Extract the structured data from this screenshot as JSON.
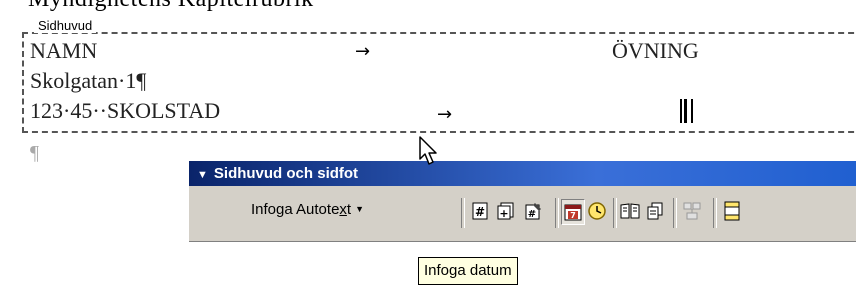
{
  "document": {
    "top_cut_text": "Myndighetens Kapitelrubrik",
    "header_label": "Sidhuvud",
    "lines": [
      {
        "left": "NAMN",
        "right": "ÖVNING"
      },
      {
        "left": "Skolgatan·1¶"
      },
      {
        "left": "123·45··SKOLSTAD"
      }
    ],
    "tab_glyph": "→",
    "body_pilcrow": "¶"
  },
  "toolbar": {
    "title": "Sidhuvud och sidfot",
    "autotext_label_pre": "Infoga Autote",
    "autotext_label_ul": "x",
    "autotext_label_post": "t",
    "buttons": [
      {
        "icon": "page-number-icon",
        "glyph": "#"
      },
      {
        "icon": "page-count-icon",
        "glyph": "+"
      },
      {
        "icon": "format-page-number-icon",
        "glyph": "#"
      },
      {
        "icon": "insert-date-icon",
        "glyph": "7",
        "pressed": true
      },
      {
        "icon": "insert-time-icon",
        "glyph": ""
      },
      {
        "icon": "page-setup-icon",
        "glyph": ""
      },
      {
        "icon": "show-hide-document-text-icon",
        "glyph": ""
      },
      {
        "icon": "same-as-previous-icon",
        "glyph": ""
      },
      {
        "icon": "switch-header-footer-icon",
        "glyph": ""
      }
    ]
  },
  "tooltip": {
    "text": "Infoga datum"
  },
  "colors": {
    "toolbar_title_bg": "#0a246a",
    "toolbar_bg": "#d4d0c8",
    "tooltip_bg": "#ffffe1"
  }
}
